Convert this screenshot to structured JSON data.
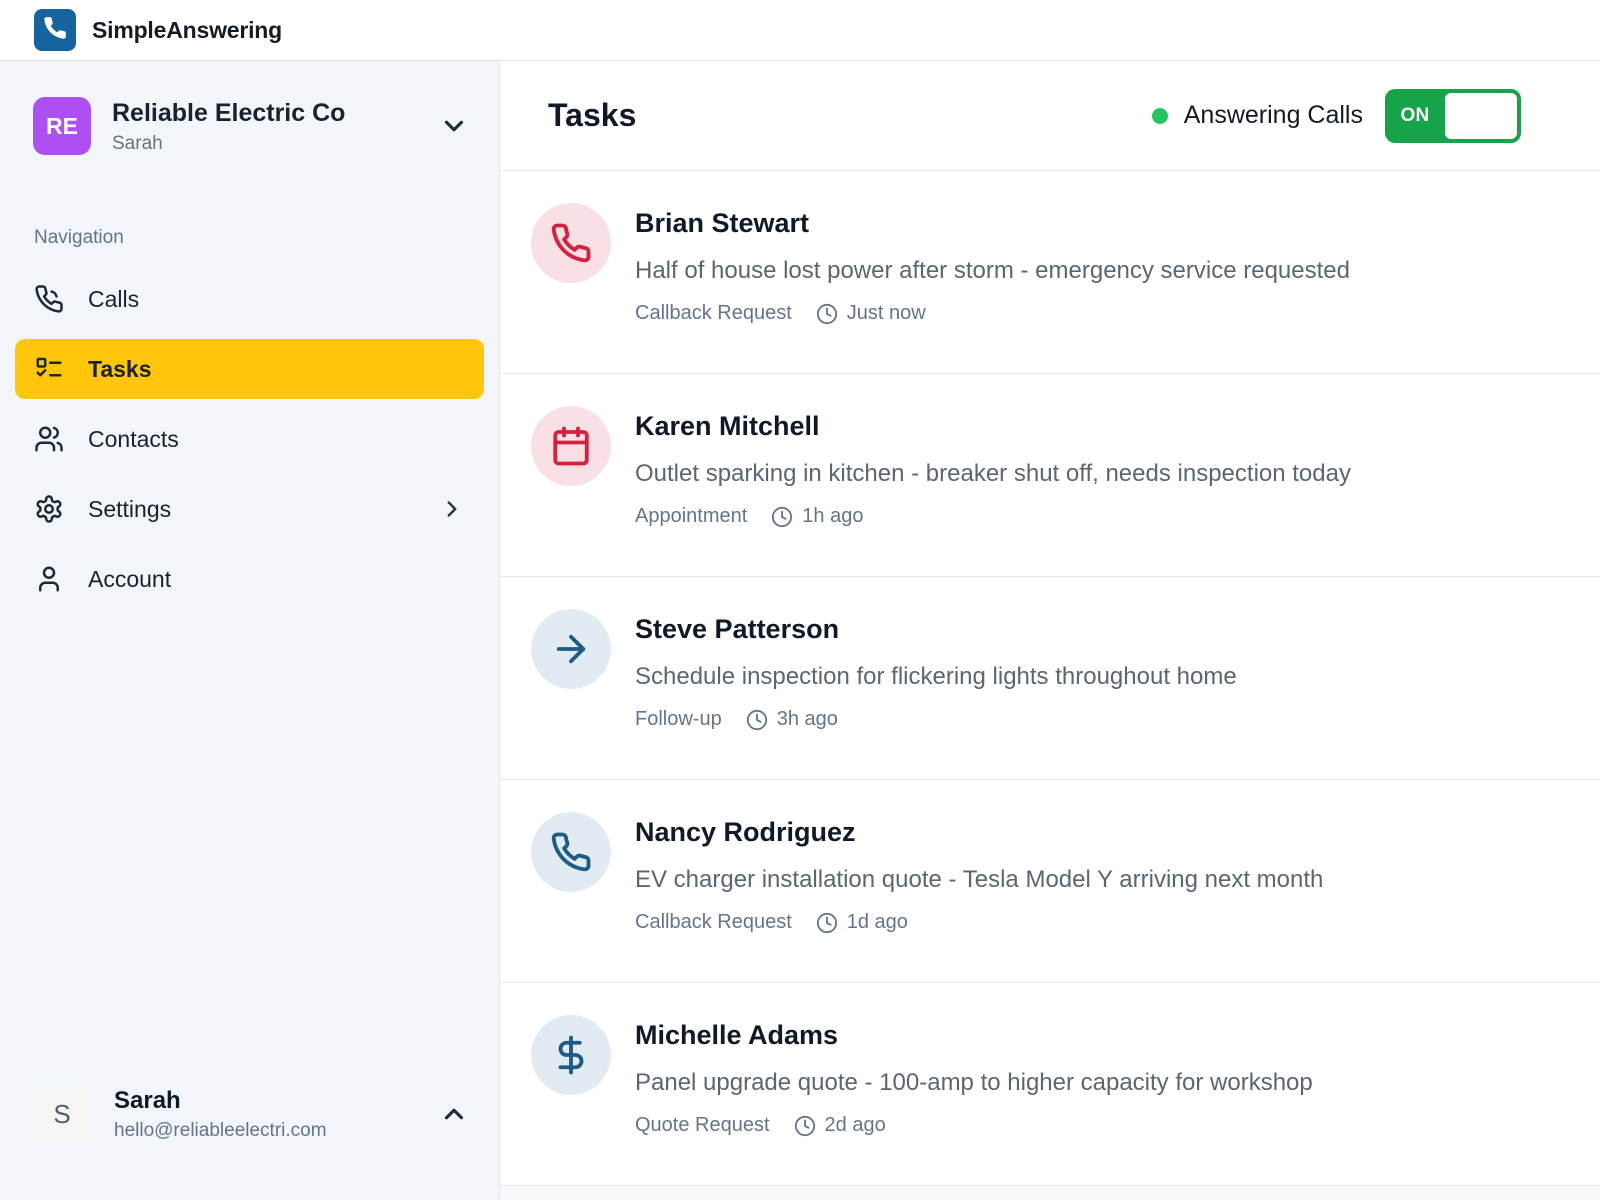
{
  "app": {
    "name": "SimpleAnswering"
  },
  "org": {
    "initials": "RE",
    "name": "Reliable Electric Co",
    "subtitle": "Sarah"
  },
  "sidebar": {
    "section_label": "Navigation",
    "items": [
      {
        "label": "Calls",
        "icon": "phone-call-icon",
        "active": false,
        "has_chevron": false
      },
      {
        "label": "Tasks",
        "icon": "checklist-icon",
        "active": true,
        "has_chevron": false
      },
      {
        "label": "Contacts",
        "icon": "contacts-icon",
        "active": false,
        "has_chevron": false
      },
      {
        "label": "Settings",
        "icon": "gear-icon",
        "active": false,
        "has_chevron": true
      },
      {
        "label": "Account",
        "icon": "person-icon",
        "active": false,
        "has_chevron": false
      }
    ],
    "user": {
      "initial": "S",
      "name": "Sarah",
      "email": "hello@reliableelectri.com"
    }
  },
  "header": {
    "title": "Tasks",
    "status_label": "Answering Calls",
    "toggle_label": "ON"
  },
  "tasks": [
    {
      "name": "Brian Stewart",
      "description": "Half of house lost power after storm - emergency service requested",
      "type": "Callback Request",
      "time": "Just now",
      "icon": "phone-icon",
      "icon_color": "red"
    },
    {
      "name": "Karen Mitchell",
      "description": "Outlet sparking in kitchen - breaker shut off, needs inspection today",
      "type": "Appointment",
      "time": "1h ago",
      "icon": "calendar-icon",
      "icon_color": "red"
    },
    {
      "name": "Steve Patterson",
      "description": "Schedule inspection for flickering lights throughout home",
      "type": "Follow-up",
      "time": "3h ago",
      "icon": "arrow-right-icon",
      "icon_color": "blue"
    },
    {
      "name": "Nancy Rodriguez",
      "description": "EV charger installation quote - Tesla Model Y arriving next month",
      "type": "Callback Request",
      "time": "1d ago",
      "icon": "phone-icon",
      "icon_color": "blue"
    },
    {
      "name": "Michelle Adams",
      "description": "Panel upgrade quote - 100-amp to higher capacity for workshop",
      "type": "Quote Request",
      "time": "2d ago",
      "icon": "dollar-icon",
      "icon_color": "blue"
    }
  ],
  "colors": {
    "brand_blue": "#15649e",
    "accent_yellow": "#ffc60b",
    "org_avatar_purple": "#ad4ff2",
    "status_green": "#22c55e",
    "toggle_green": "#17a34a",
    "task_red": "#d81f3d",
    "task_red_bg": "#f9e0e5",
    "task_blue": "#1d5c86",
    "task_blue_bg": "#e3ebf2",
    "sidebar_bg": "#f2f5f9"
  }
}
